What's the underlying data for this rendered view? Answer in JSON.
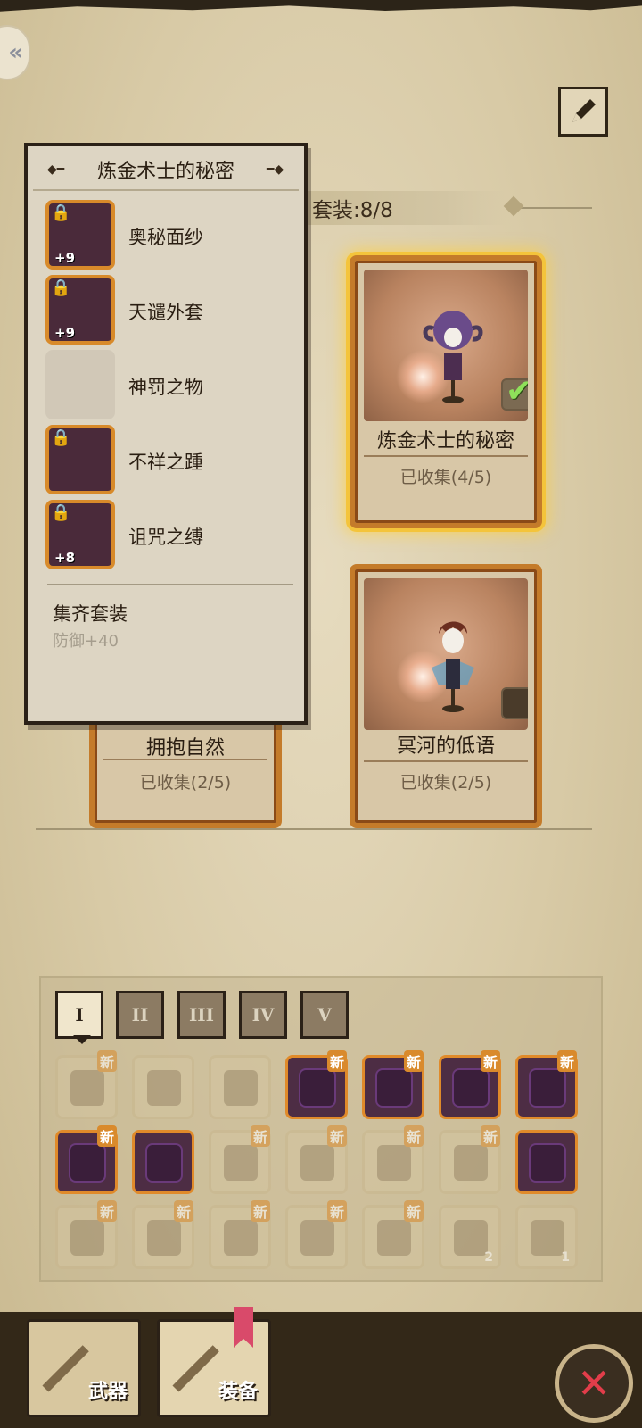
{
  "set_header": "套装:8/8",
  "tooltip": {
    "title": "炼金术士的秘密",
    "items": [
      {
        "name": "奥秘面纱",
        "level": "+9",
        "locked": true,
        "owned": true
      },
      {
        "name": "天谴外套",
        "level": "+9",
        "locked": true,
        "owned": true
      },
      {
        "name": "神罚之物",
        "level": "",
        "locked": false,
        "owned": false
      },
      {
        "name": "不祥之踵",
        "level": "",
        "locked": true,
        "owned": true
      },
      {
        "name": "诅咒之缚",
        "level": "+8",
        "locked": true,
        "owned": true
      }
    ],
    "set_bonus_title": "集齐套装",
    "set_bonus": "防御+40"
  },
  "cards": [
    {
      "title": "炼金术士的秘密",
      "progress": "已收集(4/5)",
      "selected": true,
      "checked": true
    },
    {
      "title": "冥河的低语",
      "progress": "已收集(2/5)",
      "selected": false,
      "checked": false
    },
    {
      "title": "拥抱自然",
      "progress": "已收集(2/5)",
      "selected": false,
      "checked": false
    }
  ],
  "tabs": [
    "I",
    "II",
    "III",
    "IV",
    "V"
  ],
  "active_tab": "I",
  "inventory": {
    "new_badge": "新",
    "rows": [
      [
        {
          "icon": "axe-icon",
          "owned": false,
          "new": true
        },
        {
          "icon": "tools-icon",
          "owned": false,
          "new": false
        },
        {
          "icon": "armor-icon",
          "owned": false,
          "new": false
        },
        {
          "icon": "dark-armor-icon",
          "owned": true,
          "new": true
        },
        {
          "icon": "dark-armor-icon",
          "owned": true,
          "new": true
        },
        {
          "icon": "dark-armor-icon",
          "owned": true,
          "new": true
        },
        {
          "icon": "dark-armor-icon",
          "owned": true,
          "new": true
        }
      ],
      [
        {
          "icon": "dark-armor-icon",
          "owned": true,
          "new": true
        },
        {
          "icon": "dark-armor-icon",
          "owned": true,
          "new": false
        },
        {
          "icon": "bat-armor-icon",
          "owned": false,
          "new": true
        },
        {
          "icon": "chest-armor-icon",
          "owned": false,
          "new": true
        },
        {
          "icon": "chest-armor-icon",
          "owned": false,
          "new": true
        },
        {
          "icon": "tunic-icon",
          "owned": false,
          "new": true
        },
        {
          "icon": "cursed-boots-icon",
          "owned": true,
          "new": false
        }
      ],
      [
        {
          "icon": "bracer-icon",
          "owned": false,
          "new": true
        },
        {
          "icon": "gauntlet-icon",
          "owned": false,
          "new": true
        },
        {
          "icon": "ring-icon",
          "owned": false,
          "new": true
        },
        {
          "icon": "cloak-icon",
          "owned": false,
          "new": true
        },
        {
          "icon": "satchel-icon",
          "owned": false,
          "new": true
        },
        {
          "icon": "shovel-icon",
          "owned": false,
          "new": false,
          "count": "2"
        },
        {
          "icon": "moss-icon",
          "owned": false,
          "new": false,
          "count": "1"
        }
      ]
    ]
  },
  "bottom_tabs": {
    "weapons": "武器",
    "equipment": "装备"
  },
  "colors": {
    "accent_gold": "#f4c43b",
    "frame_orange": "#c47b2a",
    "close_red": "#e23d4a"
  }
}
